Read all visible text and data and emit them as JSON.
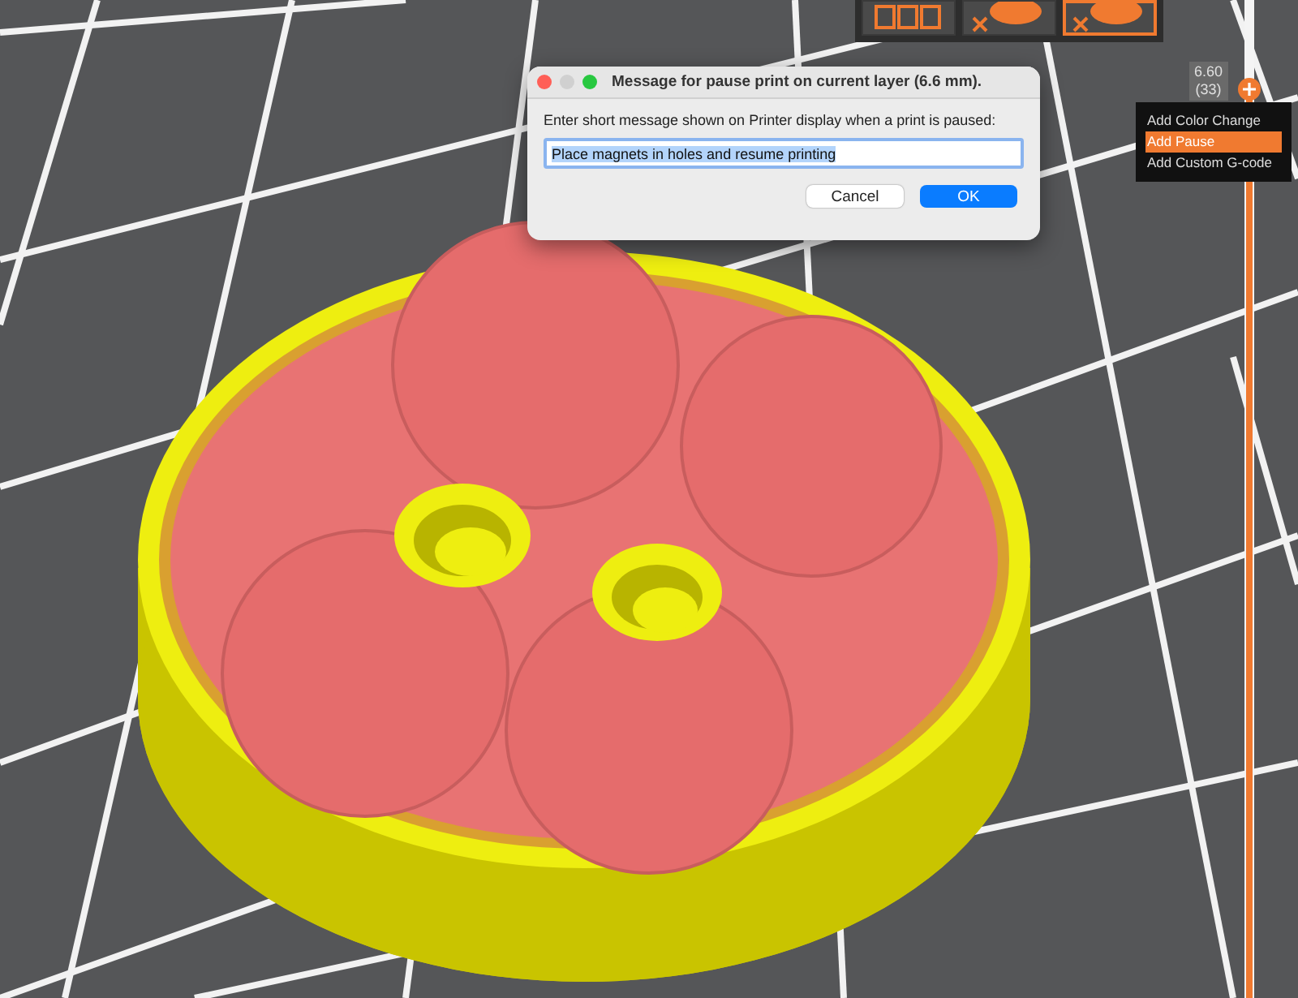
{
  "view_toolbar": {
    "items": [
      {
        "kind": "arrange",
        "selected": false
      },
      {
        "kind": "object",
        "selected": false
      },
      {
        "kind": "object",
        "selected": true
      }
    ]
  },
  "layer_slider": {
    "value": "6.60",
    "layer": "(33)",
    "level": 0.91
  },
  "context_menu": {
    "items": [
      {
        "label": "Add Color Change",
        "selected": false
      },
      {
        "label": "Add Pause",
        "selected": true
      },
      {
        "label": "Add Custom G-code",
        "selected": false
      }
    ]
  },
  "dialog": {
    "title": "Message for pause print on current layer (6.6 mm).",
    "prompt": "Enter short message shown on Printer display when a print is paused:",
    "input": {
      "value": "Place magnets in holes and resume printing",
      "selected": true
    },
    "buttons": [
      {
        "label": "Cancel",
        "kind": "secondary"
      },
      {
        "label": "OK",
        "kind": "primary"
      }
    ]
  }
}
